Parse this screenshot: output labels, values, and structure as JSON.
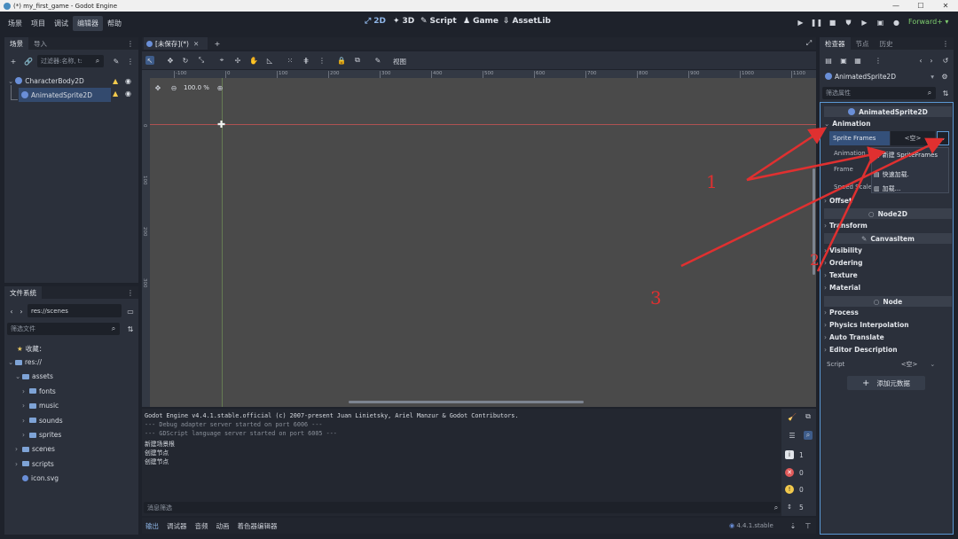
{
  "window": {
    "title": "(*) my_first_game - Godot Engine"
  },
  "menu": [
    "场景",
    "项目",
    "调试",
    "编辑器",
    "帮助"
  ],
  "workspaces": [
    {
      "icon": "2d-icon",
      "label": "2D"
    },
    {
      "icon": "3d-icon",
      "label": "3D"
    },
    {
      "icon": "script-icon",
      "label": "Script"
    },
    {
      "icon": "game-icon",
      "label": "Game"
    },
    {
      "icon": "assetlib-icon",
      "label": "AssetLib"
    }
  ],
  "renderer": "Forward+",
  "scene_dock": {
    "tabs": [
      "场景",
      "导入"
    ],
    "filter_placeholder": "过滤器:名称, t:",
    "nodes": [
      {
        "name": "CharacterBody2D",
        "warning": true
      },
      {
        "name": "AnimatedSprite2D",
        "warning": true,
        "selected": true
      }
    ]
  },
  "filesystem_dock": {
    "tab": "文件系统",
    "path": "res://scenes",
    "filter_placeholder": "筛选文件",
    "favorites": "收藏：",
    "items": [
      {
        "name": "res://",
        "level": 0,
        "type": "folder",
        "open": true
      },
      {
        "name": "assets",
        "level": 1,
        "type": "folder",
        "open": true
      },
      {
        "name": "fonts",
        "level": 2,
        "type": "folder"
      },
      {
        "name": "music",
        "level": 2,
        "type": "folder"
      },
      {
        "name": "sounds",
        "level": 2,
        "type": "folder"
      },
      {
        "name": "sprites",
        "level": 2,
        "type": "folder"
      },
      {
        "name": "scenes",
        "level": 1,
        "type": "folder"
      },
      {
        "name": "scripts",
        "level": 1,
        "type": "folder"
      },
      {
        "name": "icon.svg",
        "level": 1,
        "type": "file"
      }
    ]
  },
  "editor": {
    "tab": "[未保存](*)",
    "view_label": "视图",
    "zoom": "100.0 %",
    "ruler_top": [
      "-100",
      "0",
      "100",
      "200",
      "300",
      "400",
      "500",
      "600",
      "700",
      "800",
      "900",
      "1000",
      "1100"
    ],
    "ruler_left": [
      "0",
      "100",
      "200",
      "300"
    ]
  },
  "output": {
    "lines": [
      {
        "text": "Godot Engine v4.4.1.stable.official (c) 2007-present Juan Linietsky, Ariel Manzur & Godot Contributors.",
        "dim": false
      },
      {
        "text": "--- Debug adapter server started on port 6006 ---",
        "dim": true
      },
      {
        "text": "--- GDScript language server started on port 6005 ---",
        "dim": true
      },
      {
        "text": "新建场景根",
        "dim": false
      },
      {
        "text": "创建节点",
        "dim": false
      },
      {
        "text": "创建节点",
        "dim": false
      }
    ],
    "filter_placeholder": "消息筛选",
    "counts": {
      "info": "1",
      "errors": "0",
      "warnings": "0",
      "messages": "5"
    }
  },
  "bottom_tabs": [
    "输出",
    "调试器",
    "音频",
    "动画",
    "着色器编辑器"
  ],
  "version": "4.4.1.stable",
  "inspector": {
    "tabs": [
      "检查器",
      "节点",
      "历史"
    ],
    "object": "AnimatedSprite2D",
    "filter_placeholder": "筛选属性",
    "class_header": "AnimatedSprite2D",
    "animation_section": "Animation",
    "props": {
      "sprite_frames": "Sprite Frames",
      "empty": "<空>",
      "animation": "Animation",
      "frame": "Frame",
      "speed_scale": "Speed Scale"
    },
    "dropdown": [
      "新建 SpriteFrames",
      "快速加载...",
      "加载..."
    ],
    "sections_a": [
      "Offset"
    ],
    "node2d_header": "Node2D",
    "sections_b": [
      "Transform"
    ],
    "canvasitem_header": "CanvasItem",
    "sections_c": [
      "Visibility",
      "Ordering",
      "Texture",
      "Material"
    ],
    "node_header": "Node",
    "sections_d": [
      "Process",
      "Physics Interpolation",
      "Auto Translate",
      "Editor Description"
    ],
    "script_label": "Script",
    "script_value": "<空>",
    "add_metadata": "添加元数据"
  },
  "annotations": [
    "1",
    "2",
    "3"
  ],
  "colors": {
    "accent": "#478cbf",
    "annotation": "#e03030",
    "warning": "#f2c94c",
    "error": "#e05a5a"
  }
}
